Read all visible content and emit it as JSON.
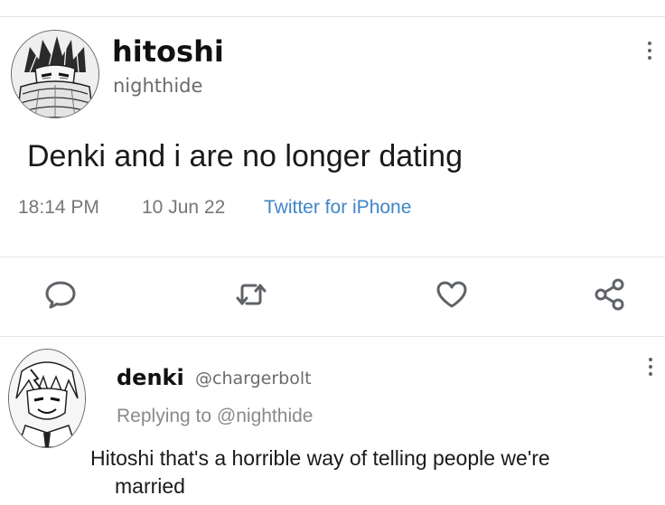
{
  "tweet": {
    "author_name": "hitoshi",
    "author_handle": "nighthide",
    "text": "Denki and i are no longer dating",
    "time": "18:14 PM",
    "date": "10 Jun 22",
    "source": "Twitter for iPhone",
    "avatar_icon": "manga-character-avatar"
  },
  "actions": [
    {
      "icon": "reply-icon"
    },
    {
      "icon": "retweet-icon"
    },
    {
      "icon": "like-icon"
    },
    {
      "icon": "share-icon"
    }
  ],
  "reply": {
    "author_name": "denki",
    "author_handle": "@chargerbolt",
    "replying_to_label": "Replying to",
    "replying_to_handle": "@nighthide",
    "text_line1": "Hitoshi that's a horrible way of telling people we're",
    "text_line2": "married",
    "avatar_icon": "manga-character-avatar"
  },
  "colors": {
    "source_link": "#3f86c8",
    "muted_text": "#777777",
    "icon": "#5f6368"
  }
}
